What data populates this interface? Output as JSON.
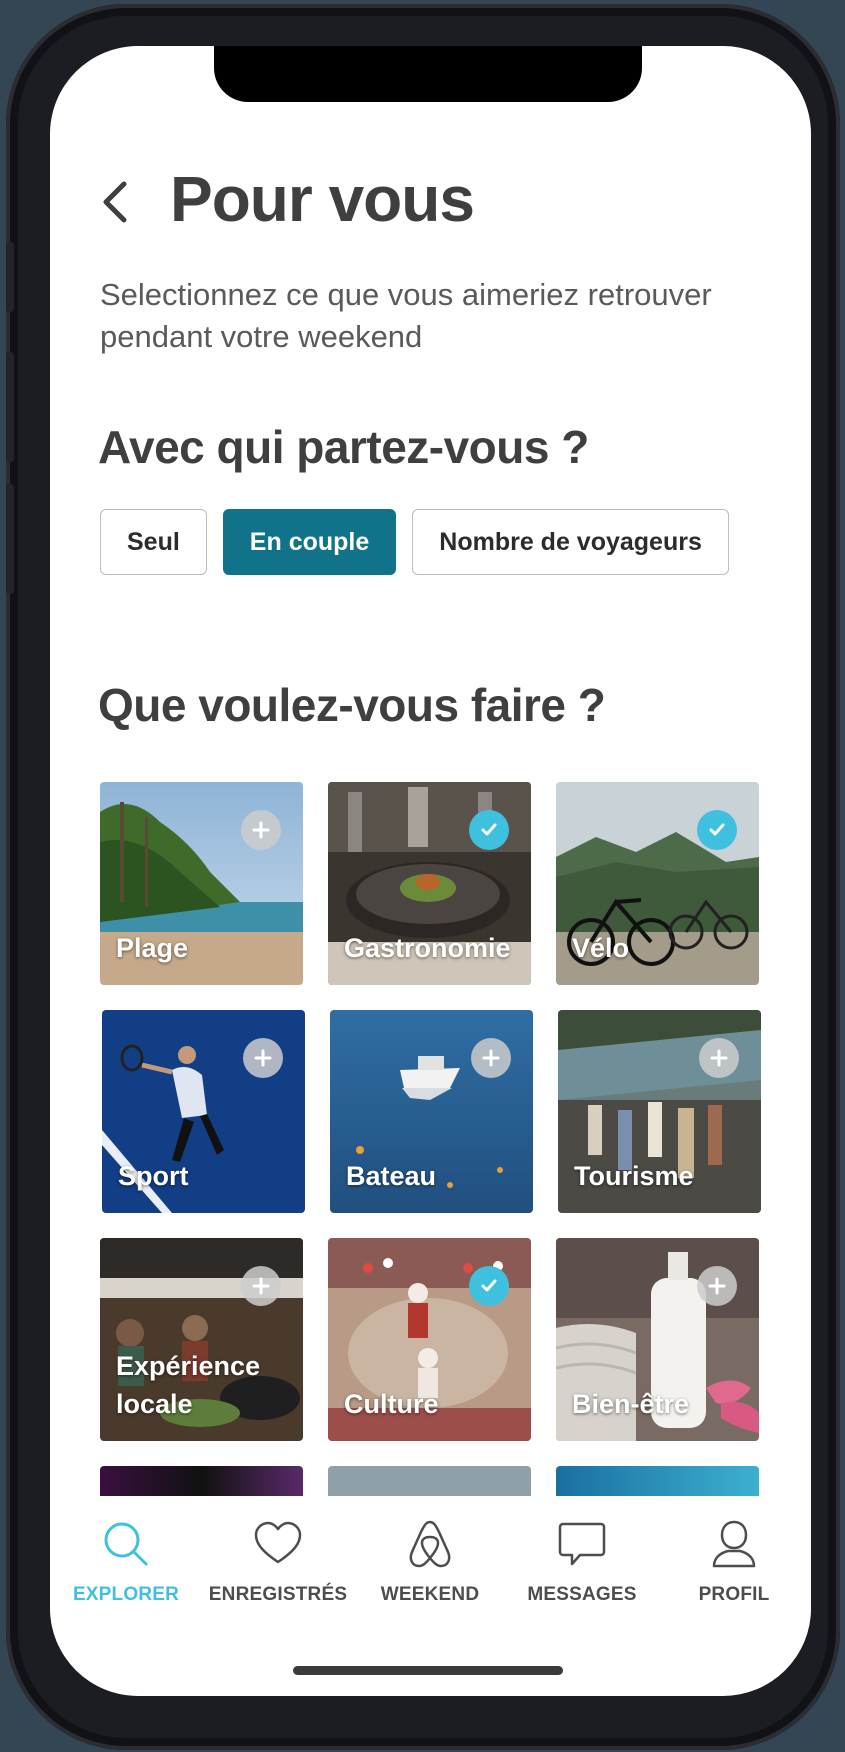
{
  "header": {
    "title": "Pour vous",
    "subtitle": "Selectionnez ce que vous aimeriez retrouver pendant votre weekend"
  },
  "companions": {
    "title": "Avec qui partez-vous ?",
    "options": [
      {
        "label": "Seul",
        "selected": false
      },
      {
        "label": "En couple",
        "selected": true
      },
      {
        "label": "Nombre de voyageurs",
        "selected": false
      }
    ]
  },
  "activities": {
    "title": "Que voulez-vous faire ?",
    "items": [
      {
        "label": "Plage",
        "selected": false
      },
      {
        "label": "Gastronomie",
        "selected": true
      },
      {
        "label": "Vélo",
        "selected": true
      },
      {
        "label": "Sport",
        "selected": false
      },
      {
        "label": "Bateau",
        "selected": false
      },
      {
        "label": "Tourisme",
        "selected": false
      },
      {
        "label": "Expérience locale",
        "selected": false
      },
      {
        "label": "Culture",
        "selected": true
      },
      {
        "label": "Bien-être",
        "selected": false
      }
    ]
  },
  "tabbar": {
    "items": [
      {
        "label": "EXPLORER",
        "icon": "search-icon",
        "active": true
      },
      {
        "label": "ENREGISTRÉS",
        "icon": "heart-icon",
        "active": false
      },
      {
        "label": "WEEKEND",
        "icon": "airbnb-logo-icon",
        "active": false
      },
      {
        "label": "MESSAGES",
        "icon": "chat-bubble-icon",
        "active": false
      },
      {
        "label": "PROFIL",
        "icon": "user-icon",
        "active": false
      }
    ]
  },
  "colors": {
    "accent": "#107389",
    "active_tab": "#3fc0de",
    "check_badge": "#3fc0de"
  }
}
